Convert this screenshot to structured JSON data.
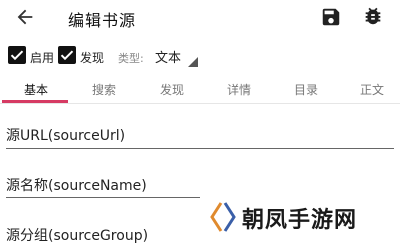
{
  "appbar": {
    "title": "编辑书源",
    "back_icon": "arrow-left-icon",
    "save_icon": "save-icon",
    "debug_icon": "bug-icon"
  },
  "options": {
    "enabled_label": "启用",
    "enabled_checked": true,
    "discover_label": "发现",
    "discover_checked": true,
    "type_label": "类型:",
    "type_value": "文本"
  },
  "tabs": [
    {
      "label": "基本",
      "active": true
    },
    {
      "label": "搜索",
      "active": false
    },
    {
      "label": "发现",
      "active": false
    },
    {
      "label": "详情",
      "active": false
    },
    {
      "label": "目录",
      "active": false
    },
    {
      "label": "正文",
      "active": false
    }
  ],
  "fields": [
    {
      "label": "源URL(sourceUrl)"
    },
    {
      "label": "源名称(sourceName)"
    },
    {
      "label": "源分组(sourceGroup)"
    }
  ],
  "watermark": {
    "text": "朝凤手游网"
  },
  "colors": {
    "accent": "#d63a63"
  }
}
